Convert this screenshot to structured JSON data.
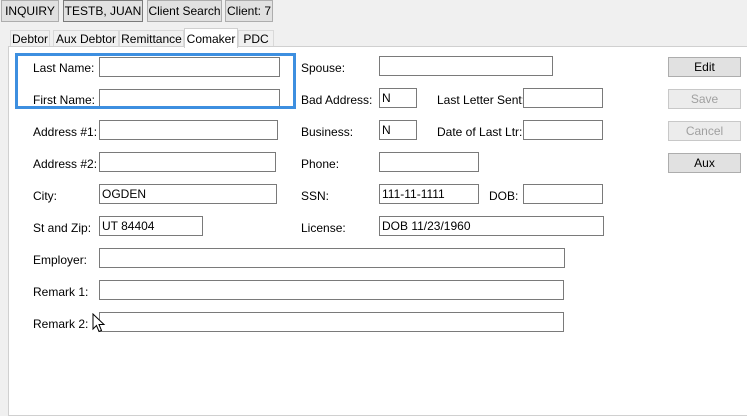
{
  "toolbar": {
    "inquiry": "INQUIRY",
    "debtor_name": "TESTB, JUAN",
    "client_search": "Client Search",
    "client": "Client: 7"
  },
  "tabs": [
    "Debtor",
    "Aux Debtor",
    "Remittance",
    "Comaker",
    "PDC"
  ],
  "active_tab": "Comaker",
  "form": {
    "last_name": {
      "label": "Last Name:",
      "value": ""
    },
    "first_name": {
      "label": "First Name:",
      "value": ""
    },
    "address1": {
      "label": "Address #1:",
      "value": ""
    },
    "address2": {
      "label": "Address #2:",
      "value": ""
    },
    "city": {
      "label": "City:",
      "value": "OGDEN"
    },
    "st_zip": {
      "label": "St and Zip:",
      "value": "UT 84404"
    },
    "employer": {
      "label": "Employer:",
      "value": ""
    },
    "remark1": {
      "label": "Remark 1:",
      "value": ""
    },
    "remark2": {
      "label": "Remark 2:",
      "value": ""
    },
    "spouse": {
      "label": "Spouse:",
      "value": ""
    },
    "bad_address": {
      "label": "Bad Address:",
      "value": "N"
    },
    "business": {
      "label": "Business:",
      "value": "N"
    },
    "phone": {
      "label": "Phone:",
      "value": ""
    },
    "ssn": {
      "label": "SSN:",
      "value": "111-11-1111"
    },
    "license": {
      "label": "License:",
      "value": "DOB 11/23/1960"
    },
    "last_letter_sent": {
      "label": "Last Letter Sent:",
      "value": ""
    },
    "date_last_ltr": {
      "label": "Date of Last Ltr:",
      "value": ""
    },
    "dob": {
      "label": "DOB:",
      "value": ""
    }
  },
  "actions": {
    "edit": "Edit",
    "save": "Save",
    "cancel": "Cancel",
    "aux": "Aux"
  },
  "colors": {
    "highlight": "#3d8fe0",
    "panel": "#ffffff",
    "window": "#f0f0f0"
  }
}
